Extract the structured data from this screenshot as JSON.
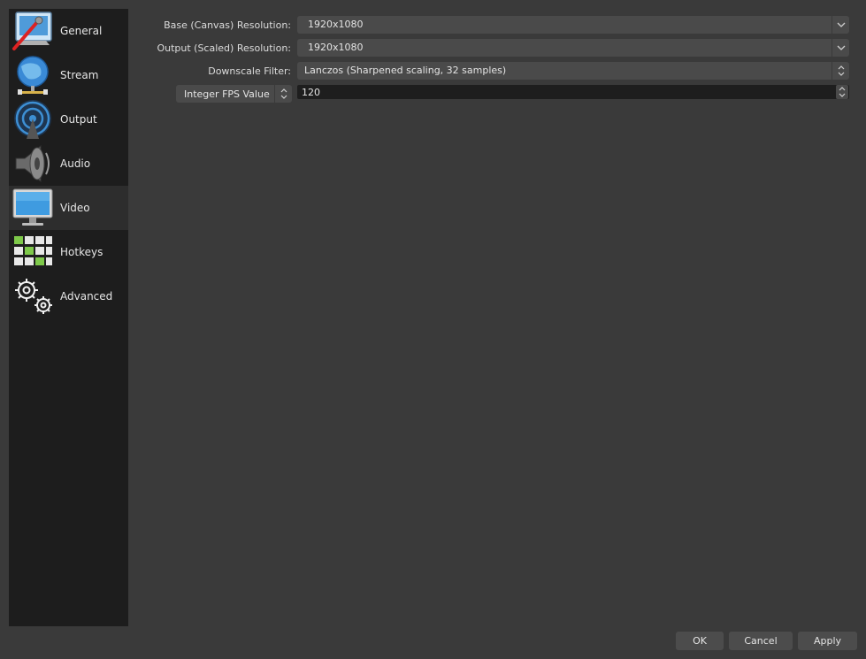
{
  "sidebar": {
    "items": [
      {
        "label": "General",
        "icon": "general-icon"
      },
      {
        "label": "Stream",
        "icon": "stream-icon"
      },
      {
        "label": "Output",
        "icon": "output-icon"
      },
      {
        "label": "Audio",
        "icon": "audio-icon"
      },
      {
        "label": "Video",
        "icon": "video-icon",
        "selected": true
      },
      {
        "label": "Hotkeys",
        "icon": "hotkeys-icon"
      },
      {
        "label": "Advanced",
        "icon": "advanced-icon"
      }
    ]
  },
  "video": {
    "base_resolution": {
      "label": "Base (Canvas) Resolution:",
      "value": "1920x1080"
    },
    "output_resolution": {
      "label": "Output (Scaled) Resolution:",
      "value": "1920x1080"
    },
    "downscale_filter": {
      "label": "Downscale Filter:",
      "value": "Lanczos (Sharpened scaling, 32 samples)"
    },
    "fps": {
      "type": "Integer FPS Value",
      "value": "120"
    }
  },
  "buttons": {
    "ok": "OK",
    "cancel": "Cancel",
    "apply": "Apply"
  },
  "colors": {
    "background": "#3a3a3a",
    "sidebar": "#1d1d1d",
    "selected": "#2d2d2d",
    "control": "#4a4a4a"
  }
}
